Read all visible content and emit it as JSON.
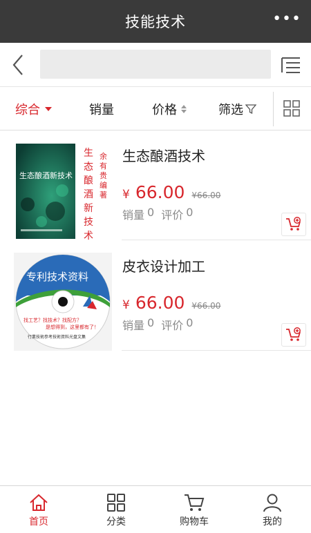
{
  "header": {
    "title": "技能技术",
    "more_label": "•••"
  },
  "search": {
    "value": "",
    "placeholder": ""
  },
  "sort": {
    "items": [
      "综合",
      "销量",
      "价格",
      "筛选"
    ],
    "active_index": 0
  },
  "products": [
    {
      "name": "生态酿酒技术",
      "currency": "¥",
      "price": "66.00",
      "old_price": "¥66.00",
      "sales_label": "销量",
      "sales": "0",
      "reviews_label": "评价",
      "reviews": "0",
      "thumb": {
        "book_title": "生态酿酒新技术",
        "side_title": "生态酿酒新技术",
        "side_author": "余有贵编著"
      }
    },
    {
      "name": "皮衣设计加工",
      "currency": "¥",
      "price": "66.00",
      "old_price": "¥66.00",
      "sales_label": "销量",
      "sales": "0",
      "reviews_label": "评价",
      "reviews": "0",
      "thumb": {
        "disc_title": "专利技术资料",
        "disc_line1": "找工艺？找技术？找配方？",
        "disc_line2": "是想得到，这里都有了！",
        "disc_footer": "行業技術参考技術資料光盘文集"
      }
    }
  ],
  "tabbar": {
    "items": [
      "首页",
      "分类",
      "购物车",
      "我的"
    ],
    "active_index": 0
  },
  "colors": {
    "accent": "#d8272d",
    "header_bg": "#3a3a3a"
  }
}
